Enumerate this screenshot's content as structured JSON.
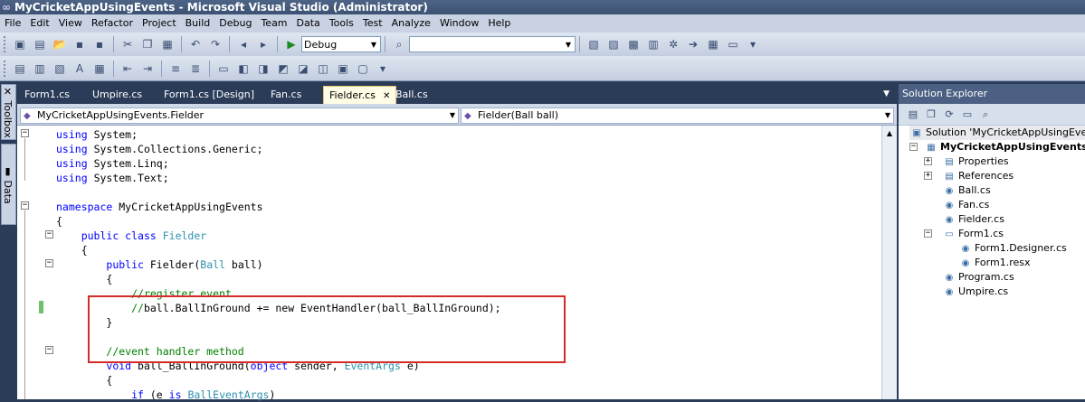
{
  "window": {
    "title": "MyCricketAppUsingEvents - Microsoft Visual Studio (Administrator)"
  },
  "menu": [
    "File",
    "Edit",
    "View",
    "Refactor",
    "Project",
    "Build",
    "Debug",
    "Team",
    "Data",
    "Tools",
    "Test",
    "Analyze",
    "Window",
    "Help"
  ],
  "toolbar": {
    "config_value": "Debug",
    "find_value": ""
  },
  "left_tabs": {
    "toolbox": "Toolbox",
    "data_sources": "Data Sources"
  },
  "tabs": [
    {
      "label": "Form1.cs",
      "active": false
    },
    {
      "label": "Umpire.cs",
      "active": false
    },
    {
      "label": "Form1.cs [Design]",
      "active": false
    },
    {
      "label": "Fan.cs",
      "active": false
    },
    {
      "label": "Fielder.cs",
      "active": true
    },
    {
      "label": "Ball.cs",
      "active": false
    }
  ],
  "nav": {
    "type_combo": "MyCricketAppUsingEvents.Fielder",
    "member_combo": "Fielder(Ball ball)"
  },
  "code_lines": [
    "using System;",
    "using System.Collections.Generic;",
    "using System.Linq;",
    "using System.Text;",
    "",
    "namespace MyCricketAppUsingEvents",
    "{",
    "    public class Fielder",
    "    {",
    "        public Fielder(Ball ball)",
    "        {",
    "            //register event",
    "            //ball.BallInGround += new EventHandler(ball_BallInGround);",
    "        }",
    "",
    "        //event handler method",
    "        void ball_BallInGround(object sender, EventArgs e)",
    "        {",
    "            if (e is BallEventArgs)"
  ],
  "solution_explorer": {
    "title": "Solution Explorer",
    "solution": "Solution 'MyCricketAppUsingEvents'",
    "project": "MyCricketAppUsingEvents",
    "items": [
      "Properties",
      "References",
      "Ball.cs",
      "Fan.cs",
      "Fielder.cs",
      "Form1.cs",
      "Form1.Designer.cs",
      "Form1.resx",
      "Program.cs",
      "Umpire.cs"
    ]
  },
  "colors": {
    "keyword": "#0000ff",
    "type": "#2b91af",
    "comment": "#008000",
    "highlight_box": "#d42a2a",
    "chrome": "#2b3c59"
  }
}
